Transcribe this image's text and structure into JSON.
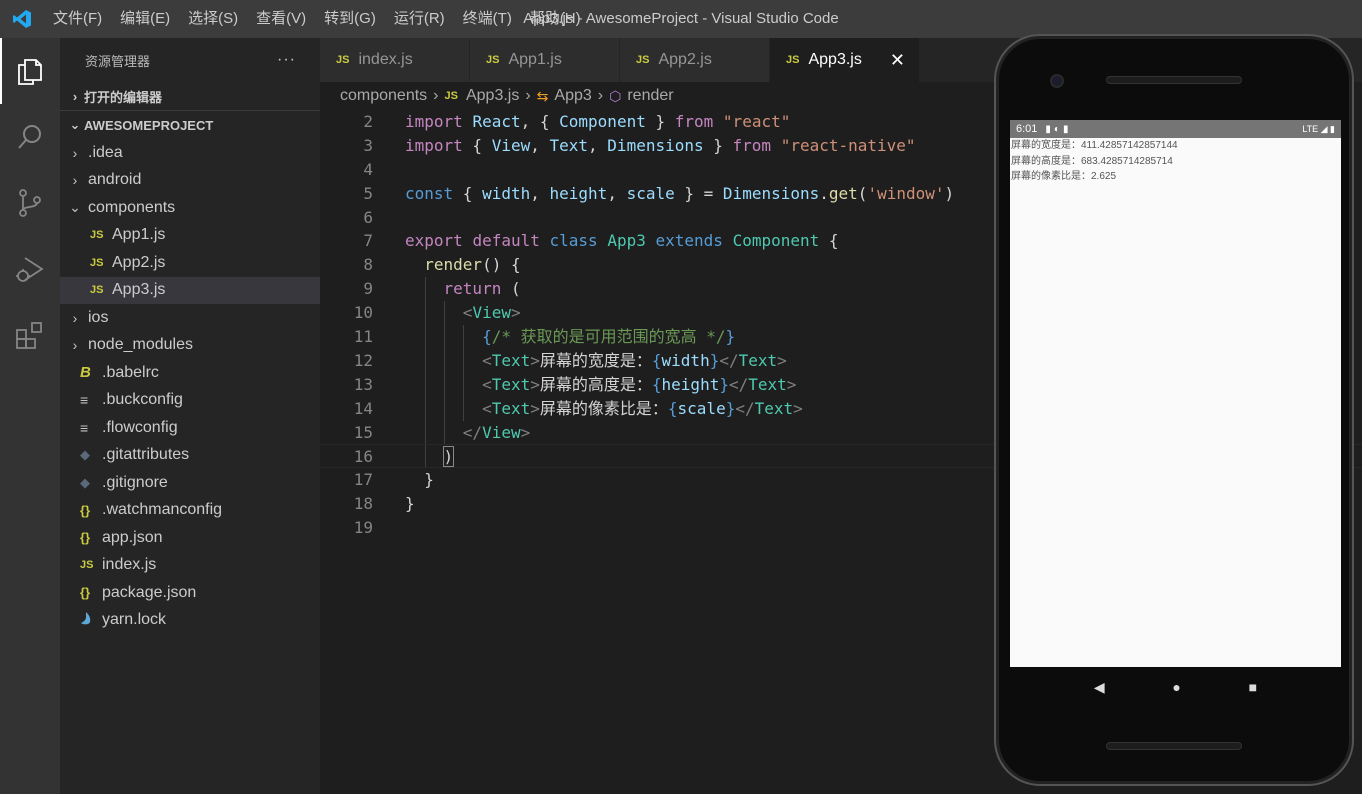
{
  "titlebar": {
    "window_title": "App3.js - AwesomeProject - Visual Studio Code",
    "menus": [
      "文件(F)",
      "编辑(E)",
      "选择(S)",
      "查看(V)",
      "转到(G)",
      "运行(R)",
      "终端(T)",
      "帮助(H)"
    ]
  },
  "activity": {
    "icons": [
      "explorer-icon",
      "search-icon",
      "source-control-icon",
      "run-debug-icon",
      "extensions-icon"
    ]
  },
  "sidebar": {
    "header": "资源管理器",
    "more": "···",
    "open_editors": "打开的编辑器",
    "project": "AWESOMEPROJECT",
    "tree": [
      {
        "label": ".idea",
        "type": "folder",
        "icon": "chevron-right"
      },
      {
        "label": "android",
        "type": "folder",
        "icon": "chevron-right"
      },
      {
        "label": "components",
        "type": "folder-open",
        "icon": "chevron-down"
      },
      {
        "label": "App1.js",
        "type": "js",
        "icon": "JS"
      },
      {
        "label": "App2.js",
        "type": "js",
        "icon": "JS"
      },
      {
        "label": "App3.js",
        "type": "js",
        "icon": "JS"
      },
      {
        "label": "ios",
        "type": "folder",
        "icon": "chevron-right"
      },
      {
        "label": "node_modules",
        "type": "folder",
        "icon": "chevron-right"
      },
      {
        "label": ".babelrc",
        "type": "babel",
        "icon": "B"
      },
      {
        "label": ".buckconfig",
        "type": "lines",
        "icon": "≡"
      },
      {
        "label": ".flowconfig",
        "type": "lines",
        "icon": "≡"
      },
      {
        "label": ".gitattributes",
        "type": "git",
        "icon": "◆"
      },
      {
        "label": ".gitignore",
        "type": "git",
        "icon": "◆"
      },
      {
        "label": ".watchmanconfig",
        "type": "json",
        "icon": "{}"
      },
      {
        "label": "app.json",
        "type": "json",
        "icon": "{}"
      },
      {
        "label": "index.js",
        "type": "js",
        "icon": "JS"
      },
      {
        "label": "package.json",
        "type": "json",
        "icon": "{}"
      },
      {
        "label": "yarn.lock",
        "type": "yarn",
        "icon": "yarn"
      }
    ]
  },
  "tabs": [
    {
      "label": "index.js",
      "icon": "JS"
    },
    {
      "label": "App1.js",
      "icon": "JS"
    },
    {
      "label": "App2.js",
      "icon": "JS"
    },
    {
      "label": "App3.js",
      "icon": "JS",
      "close": "✕"
    }
  ],
  "breadcrumb": {
    "folder": "components",
    "file": "App3.js",
    "class": "App3",
    "method": "render"
  },
  "code_line_numbers": [
    "2",
    "3",
    "4",
    "5",
    "6",
    "7",
    "8",
    "9",
    "10",
    "11",
    "12",
    "13",
    "14",
    "15",
    "16",
    "17",
    "18",
    "19"
  ],
  "emulator": {
    "time": "6:01",
    "network": "LTE",
    "lines": [
      "屏幕的宽度是：411.42857142857144",
      "屏幕的高度是：683.4285714285714",
      "屏幕的像素比是：2.625"
    ]
  },
  "colors": {
    "editor_bg": "#1e1e1e",
    "sidebar_bg": "#252526",
    "activity_bg": "#333333",
    "titlebar_bg": "#3c3c3c",
    "js_icon": "#cbcb41",
    "vscode_blue": "#23a9f2"
  }
}
